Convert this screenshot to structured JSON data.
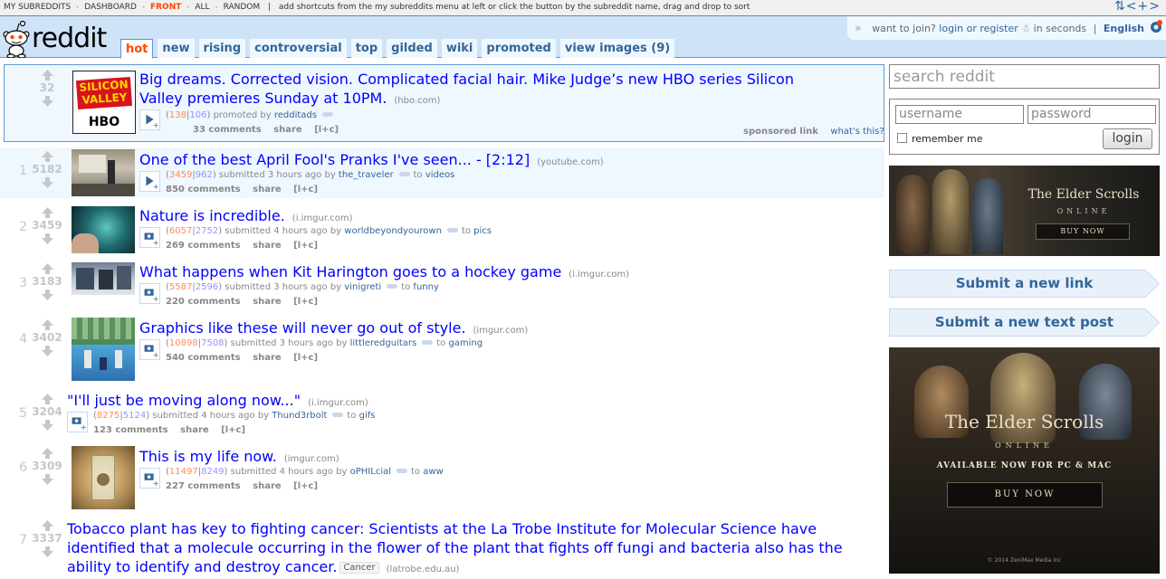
{
  "sr_bar": {
    "my_subreddits": "MY SUBREDDITS",
    "items": [
      "DASHBOARD",
      "FRONT",
      "ALL",
      "RANDOM"
    ],
    "hint": "add shortcuts from the my subreddits menu at left or click the button by the subreddit name, drag and drop to sort",
    "nav_arrows": "⇅<+>"
  },
  "header": {
    "logo": "reddit",
    "tabs": [
      "hot",
      "new",
      "rising",
      "controversial",
      "top",
      "gilded",
      "wiki",
      "promoted",
      "view images (9)"
    ],
    "selected_tab": "hot",
    "join_text": "want to join?",
    "login_link": "login or register",
    "seconds_text": "in seconds",
    "language": "English"
  },
  "sponsored": {
    "score": "32",
    "title": "Big dreams. Corrected vision. Complicated facial hair. Mike Judge’s new HBO series Silicon Valley premieres Sunday at 10PM.",
    "domain": "(hbo.com)",
    "ups": "138",
    "downs": "106",
    "promoted_by": "promoted by",
    "author": "redditads",
    "comments": "33 comments",
    "share": "share",
    "expand": "[l+c]",
    "sponsored_label": "sponsored link",
    "whats_this": "what's this?",
    "thumb_line1": "SILICON",
    "thumb_line2": "VALLEY",
    "thumb_line3": "HBO"
  },
  "links": [
    {
      "rank": "1",
      "score": "5182",
      "title": "One of the best April Fool's Pranks I've seen... - [2:12]",
      "domain": "(youtube.com)",
      "ups": "3459",
      "downs": "962",
      "time": "submitted 3 hours ago by",
      "author": "the_traveler",
      "to": "to",
      "subreddit": "videos",
      "comments": "850 comments",
      "share": "share",
      "expand": "[l+c]"
    },
    {
      "rank": "2",
      "score": "3459",
      "title": "Nature is incredible.",
      "domain": "(i.imgur.com)",
      "ups": "6057",
      "downs": "2752",
      "time": "submitted 4 hours ago by",
      "author": "worldbeyondyourown",
      "to": "to",
      "subreddit": "pics",
      "comments": "269 comments",
      "share": "share",
      "expand": "[l+c]"
    },
    {
      "rank": "3",
      "score": "3183",
      "title": "What happens when Kit Harington goes to a hockey game",
      "domain": "(i.imgur.com)",
      "ups": "5587",
      "downs": "2596",
      "time": "submitted 3 hours ago by",
      "author": "vinigreti",
      "to": "to",
      "subreddit": "funny",
      "comments": "220 comments",
      "share": "share",
      "expand": "[l+c]"
    },
    {
      "rank": "4",
      "score": "3402",
      "title": "Graphics like these will never go out of style.",
      "domain": "(imgur.com)",
      "ups": "10898",
      "downs": "7508",
      "time": "submitted 3 hours ago by",
      "author": "littleredguitars",
      "to": "to",
      "subreddit": "gaming",
      "comments": "540 comments",
      "share": "share",
      "expand": "[l+c]"
    },
    {
      "rank": "5",
      "score": "3204",
      "title": "\"I'll just be moving along now...\"",
      "domain": "(i.imgur.com)",
      "ups": "8275",
      "downs": "5124",
      "time": "submitted 4 hours ago by",
      "author": "Thund3rbolt",
      "to": "to",
      "subreddit": "gifs",
      "comments": "123 comments",
      "share": "share",
      "expand": "[l+c]"
    },
    {
      "rank": "6",
      "score": "3309",
      "title": "This is my life now.",
      "domain": "(imgur.com)",
      "ups": "11497",
      "downs": "8249",
      "time": "submitted 4 hours ago by",
      "author": "oPHILcial",
      "to": "to",
      "subreddit": "aww",
      "comments": "227 comments",
      "share": "share",
      "expand": "[l+c]"
    },
    {
      "rank": "7",
      "score": "3337",
      "title": "Tobacco plant has key to fighting cancer: Scientists at the La Trobe Institute for Molecular Science have identified that a molecule occurring in the flower of the plant that fights off fungi and bacteria also has the ability to identify and destroy cancer.",
      "flair": "Cancer",
      "domain": "(latrobe.edu.au)"
    }
  ],
  "sidebar": {
    "search_placeholder": "search reddit",
    "username_placeholder": "username",
    "password_placeholder": "password",
    "remember_me": "remember me",
    "login_button": "login",
    "submit_link": "Submit a new link",
    "submit_text": "Submit a new text post",
    "ad1": {
      "title": "The Elder Scrolls",
      "subtitle": "ONLINE",
      "cta": "BUY NOW"
    },
    "ad2": {
      "title": "The Elder Scrolls",
      "subtitle": "ONLINE",
      "tagline": "AVAILABLE NOW FOR PC & MAC",
      "cta": "BUY NOW",
      "copyright": "© 2014 ZeniMax Media Inc"
    }
  }
}
